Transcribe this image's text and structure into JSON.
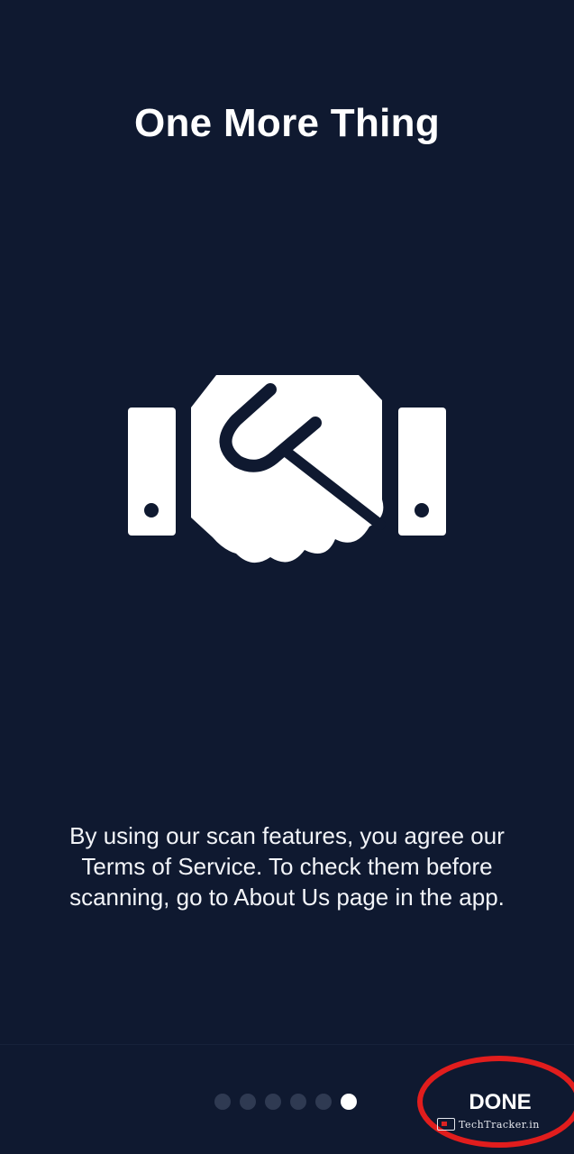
{
  "onboarding": {
    "title": "One More Thing",
    "illustration_icon": "handshake-icon",
    "description": "By using our scan features, you agree our Terms of Service. To check them before scanning, go to About Us page in the app."
  },
  "pager": {
    "total_pages": 6,
    "current_page": 6
  },
  "footer": {
    "done_label": "DONE"
  },
  "annotation": {
    "highlight_color": "#e11d1d"
  },
  "watermark": {
    "text": "TechTracker.in"
  },
  "colors": {
    "background": "#0f1930",
    "foreground": "#ffffff",
    "inactive_dot": "#2f3a52"
  }
}
